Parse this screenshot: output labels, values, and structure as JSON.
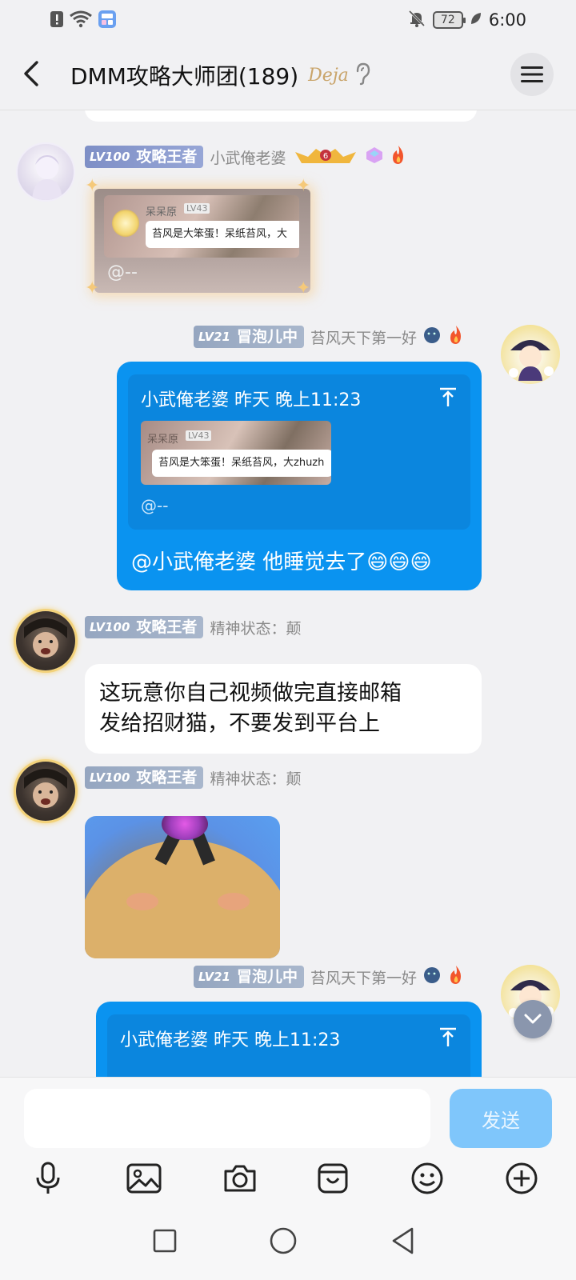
{
  "status_bar": {
    "time": "6:00",
    "battery": "72"
  },
  "header": {
    "title": "DMM攻略大师团(189)",
    "deja_badge": "Deja"
  },
  "messages": [
    {
      "level": "LV100",
      "rank": "攻略王者",
      "nickname": "小武俺老婆",
      "image_card": {
        "author": "呆呆原",
        "author_level": "LV43",
        "text": "苔风是大笨蛋！呆纸苔风，大",
        "caption": "@--"
      }
    },
    {
      "level": "LV21",
      "rank": "冒泡儿中",
      "nickname": "苔风天下第一好",
      "quote": {
        "header": "小武俺老婆 昨天 晚上11:23",
        "thumb_author": "呆呆原",
        "thumb_level": "LV43",
        "thumb_text": "苔风是大笨蛋！呆纸苔风，大zhuzh",
        "at_text": "@--"
      },
      "reply": "@小武俺老婆 他睡觉去了😄😄😄"
    },
    {
      "level": "LV100",
      "rank": "攻略王者",
      "nickname": "精神状态：颠",
      "text_lines": [
        "这玩意你自己视频做完直接邮箱",
        "发给招财猫，不要发到平台上"
      ]
    },
    {
      "level": "LV100",
      "rank": "攻略王者",
      "nickname": "精神状态：颠"
    },
    {
      "level": "LV21",
      "rank": "冒泡儿中",
      "nickname": "苔风天下第一好",
      "quote": {
        "header": "小武俺老婆 昨天 晚上11:23"
      }
    }
  ],
  "input": {
    "placeholder": "",
    "send_label": "发送"
  },
  "colors": {
    "accent_blue": "#0a93f0",
    "send_disabled": "#7fc6fb",
    "background": "#f1f1f3"
  },
  "icons": {
    "tools": [
      "microphone-icon",
      "image-icon",
      "camera-icon",
      "sticker-icon",
      "emoji-icon",
      "plus-icon"
    ],
    "nav": [
      "recents-square-icon",
      "home-circle-icon",
      "back-triangle-icon"
    ]
  }
}
